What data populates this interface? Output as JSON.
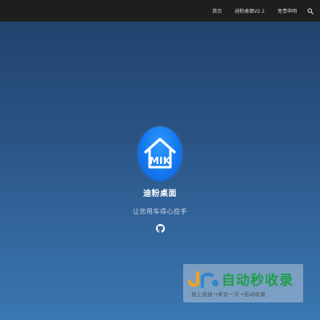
{
  "nav": {
    "items": [
      {
        "label": "首页"
      },
      {
        "label": "迪粉桌面V2.1"
      },
      {
        "label": "免责申明"
      }
    ],
    "search_icon": "search-icon"
  },
  "hero": {
    "logo_text": "MIK",
    "logo_icon": "house-icon",
    "title": "迪粉桌面",
    "tagline": "让您用车得心应手",
    "github_icon": "github-icon"
  },
  "watermark": {
    "logo_text": "JR",
    "brand": "自动秒收录",
    "subtitle": "放上链接→来访一次→自动收录"
  },
  "colors": {
    "topbar": "#1e1e1e",
    "background_top": "#1f4069",
    "background_bottom": "#3a77b2",
    "logo_blue": "#1478f0",
    "watermark_green": "#1d9e4c"
  }
}
